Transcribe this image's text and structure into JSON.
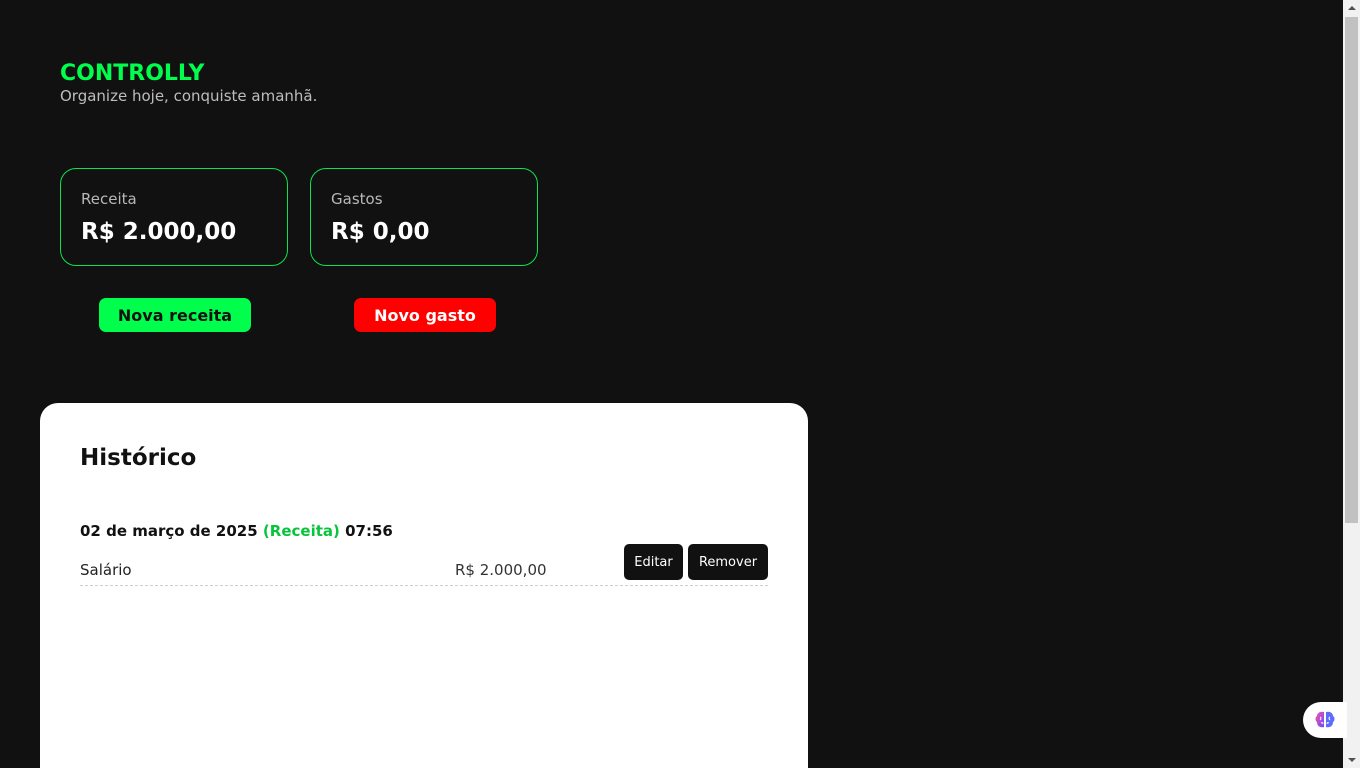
{
  "header": {
    "title": "CONTROLLY",
    "subtitle": "Organize hoje, conquiste amanhã."
  },
  "summary": {
    "income": {
      "label": "Receita",
      "value": "R$ 2.000,00"
    },
    "expenses": {
      "label": "Gastos",
      "value": "R$ 0,00"
    }
  },
  "actions": {
    "new_income": "Nova receita",
    "new_expense": "Novo gasto"
  },
  "history": {
    "title": "Histórico",
    "entries": [
      {
        "date": "02 de março de 2025",
        "type": "(Receita)",
        "time": "07:56",
        "description": "Salário",
        "amount": "R$ 2.000,00",
        "edit_label": "Editar",
        "remove_label": "Remover"
      }
    ]
  },
  "colors": {
    "accent_green": "#00ff4c",
    "expense_red": "#ff0000",
    "background": "#111111"
  },
  "icons": {
    "extension": "brain-icon"
  }
}
